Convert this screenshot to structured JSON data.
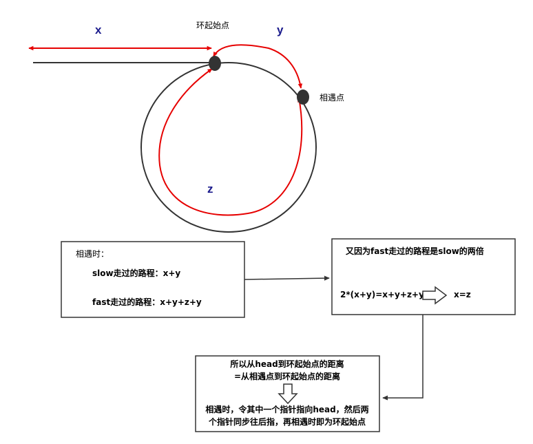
{
  "labels": {
    "x": "x",
    "y": "y",
    "z": "z",
    "loop_start": "环起始点",
    "meeting_point": "相遇点"
  },
  "box_meet": {
    "title": "相遇时：",
    "slow_line": "slow走过的路程：x+y",
    "fast_line": "fast走过的路程：x+y+z+y"
  },
  "box_double": {
    "title": "又因为fast走过的路程是slow的两倍",
    "equation": "2*(x+y)=x+y+z+y",
    "result": "x=z"
  },
  "box_conclusion": {
    "line1": "所以从head到环起始点的距离",
    "line2": "=从相遇点到环起始点的距离",
    "line3": "相遇时，令其中一个指针指向head，然后两",
    "line4": "个指针同步往后指，再相遇时即为环起始点"
  },
  "colors": {
    "red": "#e60000",
    "line": "#333333",
    "label_blue": "#1a1a8c"
  }
}
